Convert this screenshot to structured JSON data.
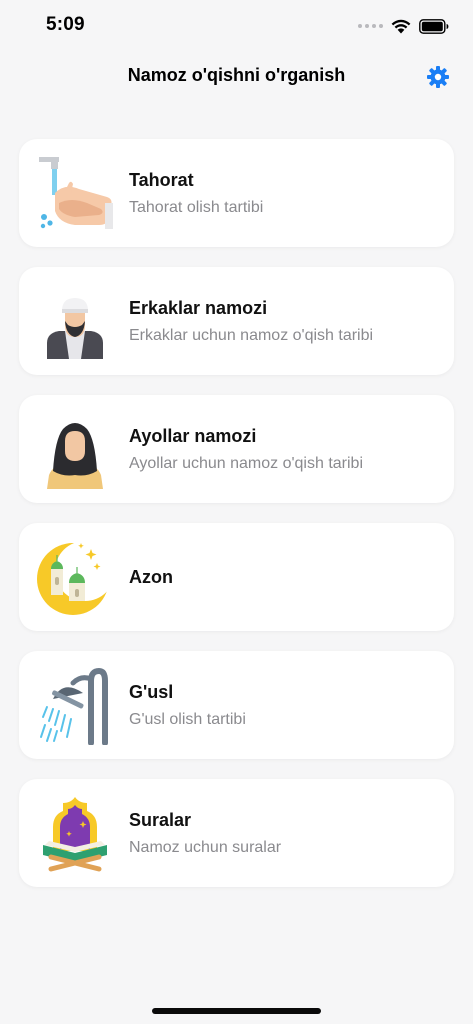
{
  "status_bar": {
    "time": "5:09"
  },
  "nav": {
    "title": "Namoz o'qishni o'rganish",
    "settings_icon": "gear-icon",
    "accent_color": "#1a7ef5"
  },
  "items": [
    {
      "id": "tahorat",
      "title": "Tahorat",
      "subtitle": "Tahorat olish tartibi",
      "icon": "hand-washing-icon"
    },
    {
      "id": "erkaklar",
      "title": "Erkaklar namozi",
      "subtitle": "Erkaklar uchun namoz o'qish taribi",
      "icon": "man-icon"
    },
    {
      "id": "ayollar",
      "title": "Ayollar namozi",
      "subtitle": "Ayollar uchun namoz o'qish taribi",
      "icon": "woman-icon"
    },
    {
      "id": "azon",
      "title": "Azon",
      "subtitle": "",
      "icon": "crescent-mosque-icon"
    },
    {
      "id": "gusl",
      "title": "G'usl",
      "subtitle": "G'usl olish tartibi",
      "icon": "shower-icon"
    },
    {
      "id": "suralar",
      "title": "Suralar",
      "subtitle": "Namoz uchun suralar",
      "icon": "quran-icon"
    }
  ]
}
